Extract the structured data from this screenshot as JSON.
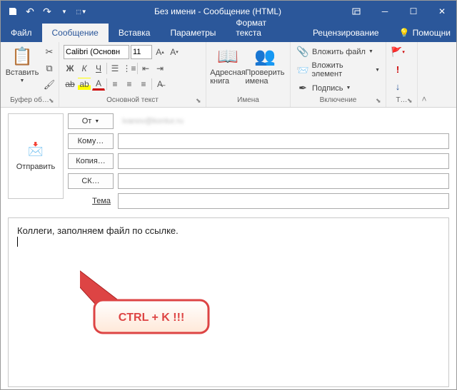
{
  "title": "Без имени - Сообщение (HTML)",
  "qat": {
    "save": "save",
    "undo": "undo",
    "redo": "redo"
  },
  "tabs": {
    "file": "Файл",
    "message": "Сообщение",
    "insert": "Вставка",
    "options": "Параметры",
    "format": "Формат текста",
    "review": "Рецензирование",
    "help": "Помощни"
  },
  "ribbon": {
    "clipboard": {
      "label": "Буфер об…",
      "paste": "Вставить"
    },
    "font": {
      "label": "Основной текст",
      "name": "Calibri (Основн",
      "size": "11",
      "bold": "Ж",
      "italic": "К",
      "underline": "Ч"
    },
    "names": {
      "label": "Имена",
      "addressbook": "Адресная книга",
      "checknames": "Проверить имена"
    },
    "include": {
      "label": "Включение",
      "attachfile": "Вложить файл",
      "attachitem": "Вложить элемент",
      "signature": "Подпись"
    },
    "tags": {
      "label": "Т…"
    }
  },
  "compose": {
    "send": "Отправить",
    "from": "От",
    "from_value": "ivanov@kontur.ru",
    "to": "Кому…",
    "cc": "Копия…",
    "bcc": "СК…",
    "subject": "Тема"
  },
  "body": {
    "text": "Коллеги, заполняем файл по ссылке."
  },
  "callout": "CTRL + K !!!"
}
